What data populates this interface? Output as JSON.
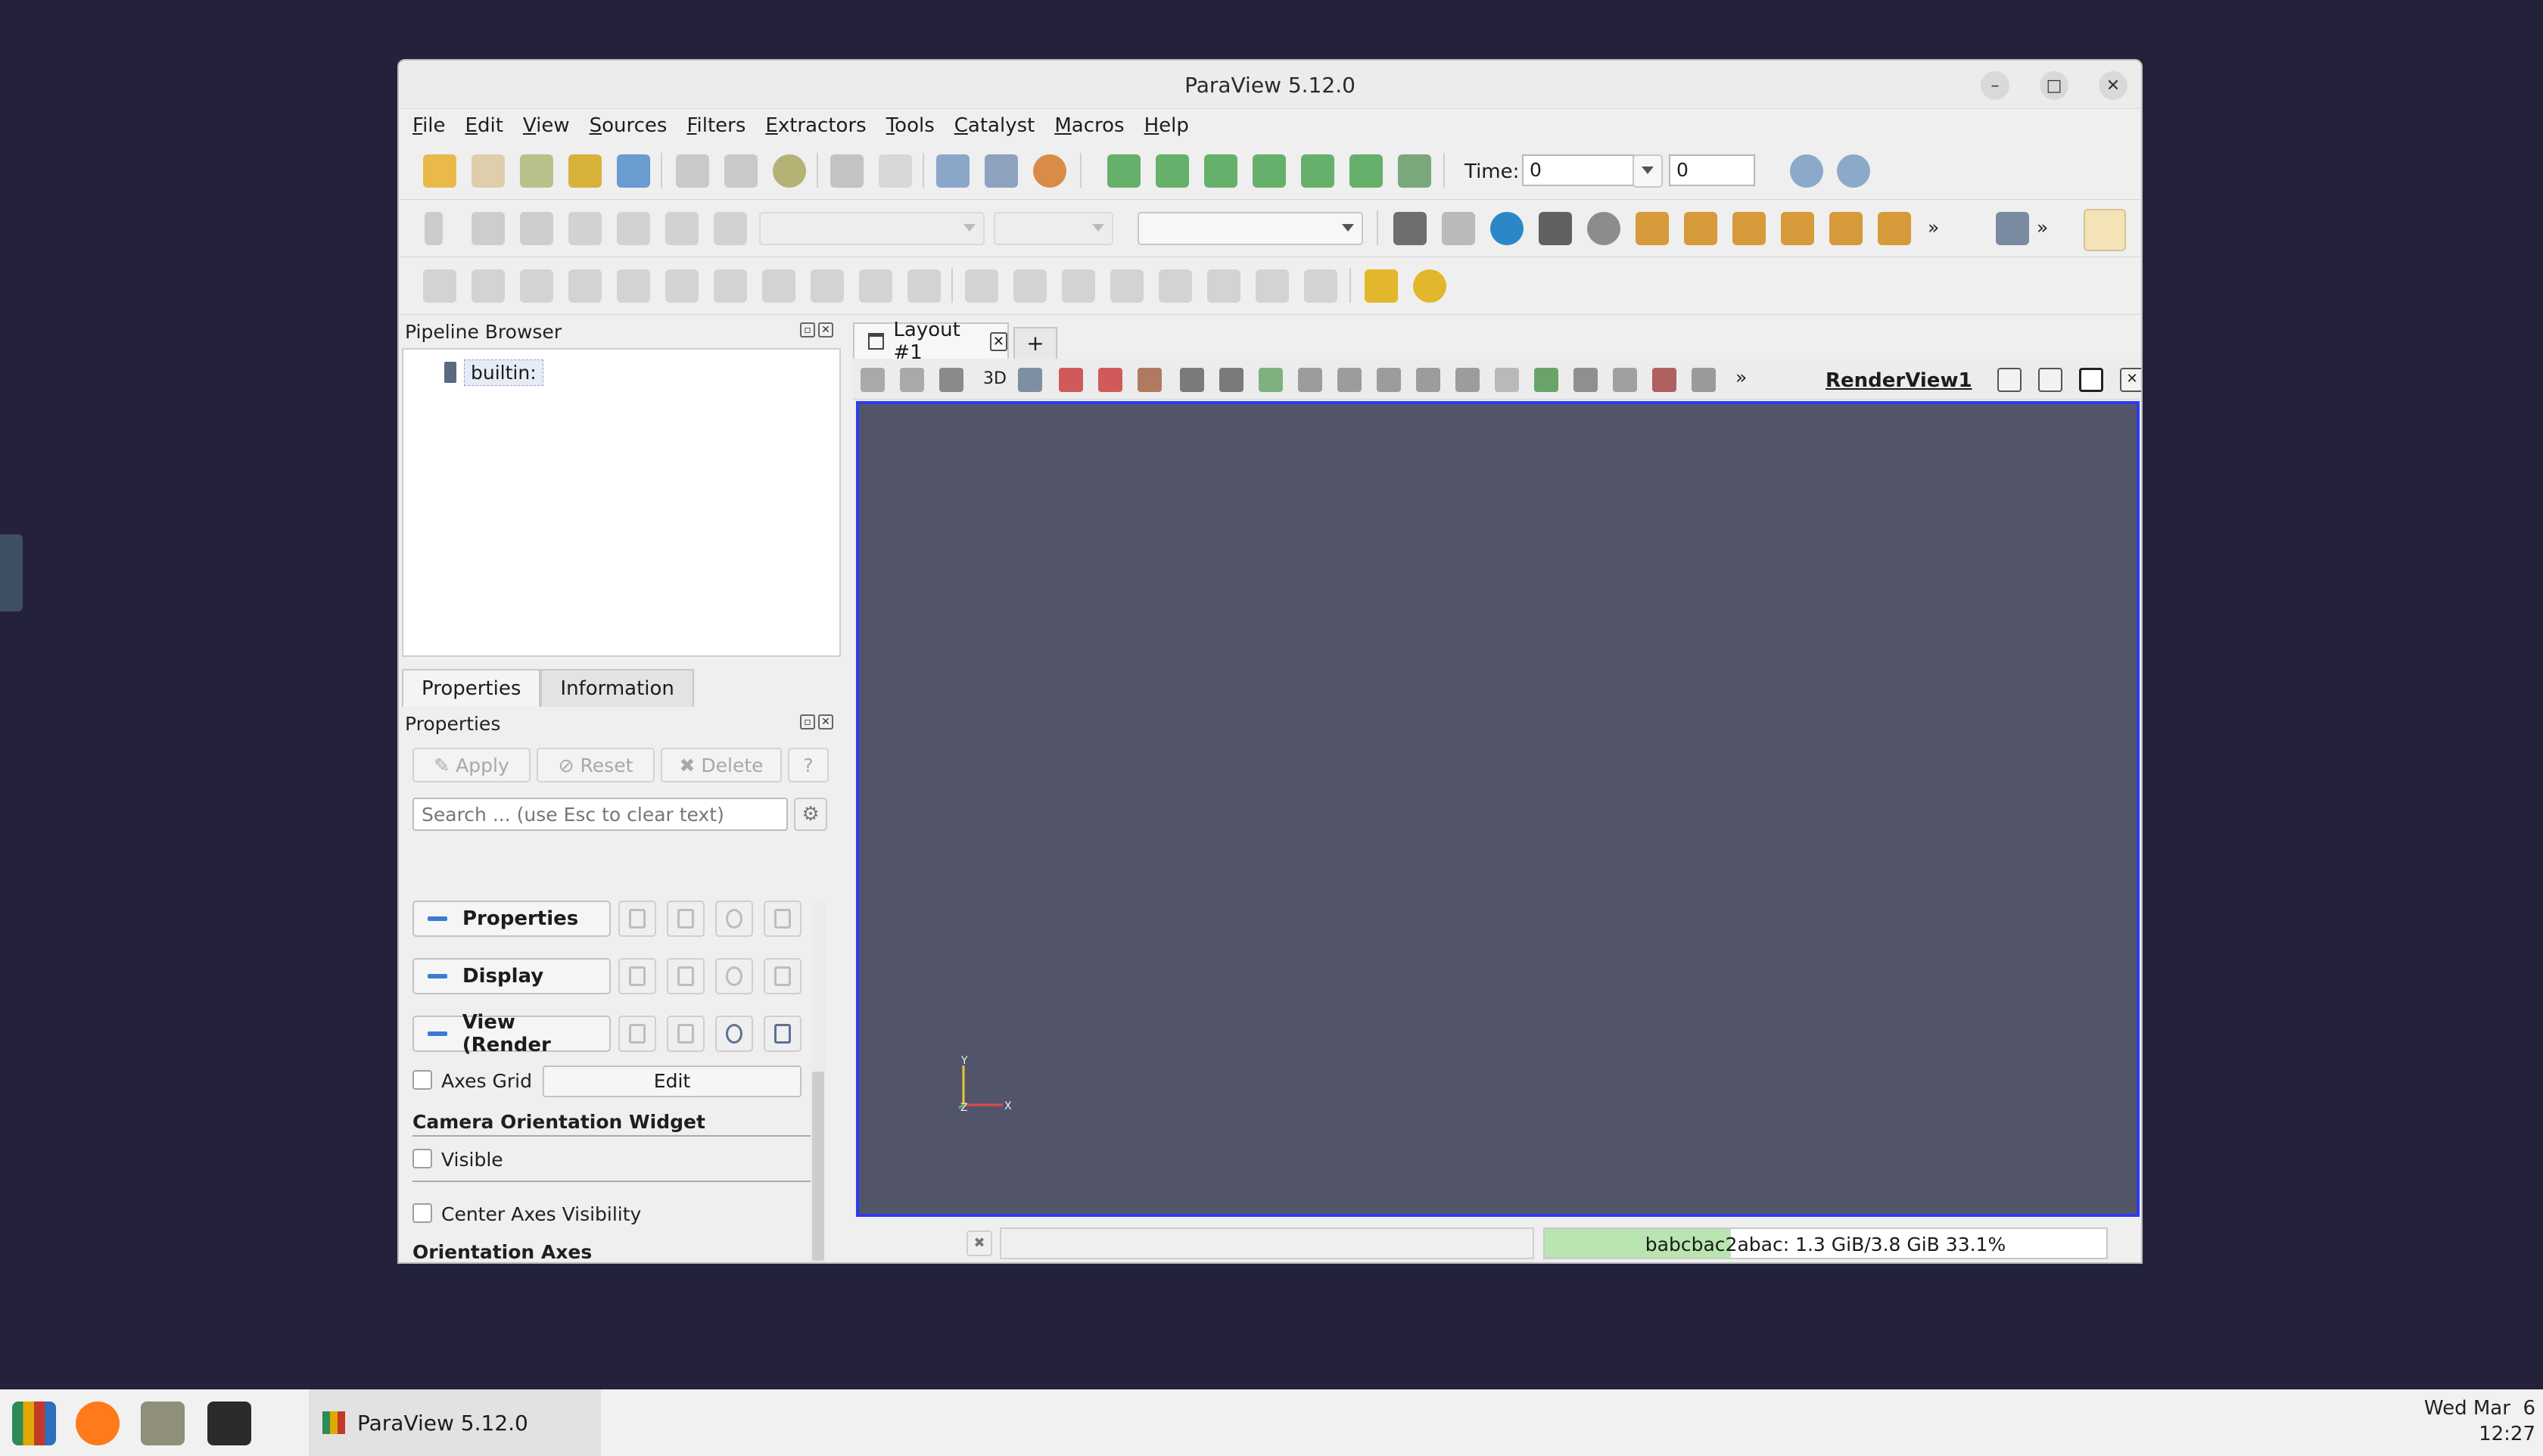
{
  "window": {
    "title": "ParaView 5.12.0",
    "controls": [
      "minimize",
      "maximize",
      "close"
    ]
  },
  "menu": [
    "File",
    "Edit",
    "View",
    "Sources",
    "Filters",
    "Extractors",
    "Tools",
    "Catalyst",
    "Macros",
    "Help"
  ],
  "toolbar": {
    "time_label": "Time:",
    "time_value": "0",
    "timestep_value": "0"
  },
  "pipeline_browser": {
    "title": "Pipeline Browser",
    "items": [
      {
        "label": "builtin:"
      }
    ]
  },
  "panel_tabs": [
    "Properties",
    "Information"
  ],
  "properties": {
    "title": "Properties",
    "buttons": {
      "apply": "Apply",
      "reset": "Reset",
      "delete": "Delete",
      "help": "?"
    },
    "search_placeholder": "Search ... (use Esc to clear text)",
    "sections": [
      "Properties",
      "Display",
      "View (Render"
    ],
    "axes_grid_label": "Axes Grid",
    "edit_label": "Edit",
    "camera_widget_heading": "Camera Orientation Widget",
    "visible_label": "Visible",
    "center_axes_label": "Center Axes Visibility",
    "orientation_axes_heading": "Orientation Axes"
  },
  "layout": {
    "tab_label": "Layout #1",
    "add_tab": "+",
    "view_toolbar_3d": "3D",
    "render_view_label": "RenderView1",
    "more": "»"
  },
  "axes_widget": {
    "x": "X",
    "y": "Y",
    "z": "Z"
  },
  "status": {
    "memory_text": "babcbac2abac: 1.3 GiB/3.8 GiB 33.1%",
    "memory_fraction": 0.331
  },
  "taskbar": {
    "app_title": "ParaView 5.12.0",
    "date": "Wed Mar  6",
    "time": "12:27"
  },
  "colors": {
    "desktop": "#23223a",
    "render_bg": "#525569",
    "active_view_border": "#2f3bf0",
    "memory_fill": "#b9e5b0",
    "accent": "#3a7bd5"
  }
}
